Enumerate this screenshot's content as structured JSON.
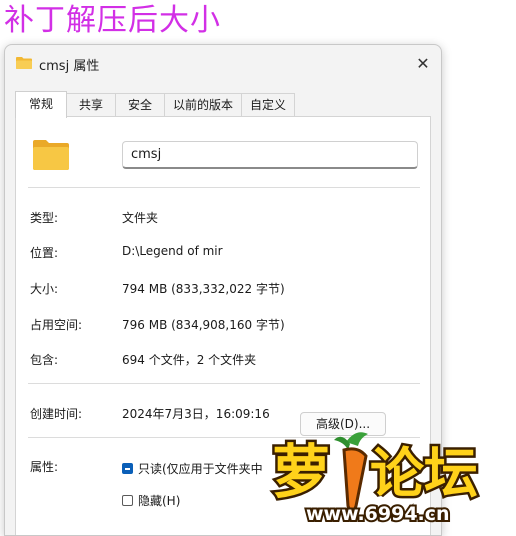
{
  "caption": "补丁解压后大小",
  "window": {
    "title": "cmsj 属性",
    "close_glyph": "✕"
  },
  "tabs": [
    {
      "label": "常规",
      "active": true
    },
    {
      "label": "共享",
      "active": false
    },
    {
      "label": "安全",
      "active": false
    },
    {
      "label": "以前的版本",
      "active": false
    },
    {
      "label": "自定义",
      "active": false
    }
  ],
  "general": {
    "name_value": "cmsj",
    "type_label": "类型:",
    "type_value": "文件夹",
    "location_label": "位置:",
    "location_value": "D:\\Legend of mir",
    "size_label": "大小:",
    "size_value": "794 MB (833,332,022 字节)",
    "disk_label": "占用空间:",
    "disk_value": "796 MB (834,908,160 字节)",
    "contains_label": "包含:",
    "contains_value": "694 个文件，2 个文件夹",
    "created_label": "创建时间:",
    "created_value": "2024年7月3日，16:09:16",
    "attributes_label": "属性:",
    "readonly_label": "只读(仅应用于文件夹中",
    "readonly_state": "indeterminate",
    "hidden_label": "隐藏(H)",
    "hidden_state": "unchecked",
    "advanced_label": "高级(D)..."
  },
  "watermark": {
    "text": "萝卜论坛",
    "url": "www.6994.cn"
  },
  "colors": {
    "caption": "#d22fe6",
    "folder": "#f7c744",
    "checkbox_accent": "#0a5fb8",
    "watermark_fill": "#ffd21a"
  },
  "icons": {
    "folder": "folder-icon",
    "close": "close-icon"
  }
}
